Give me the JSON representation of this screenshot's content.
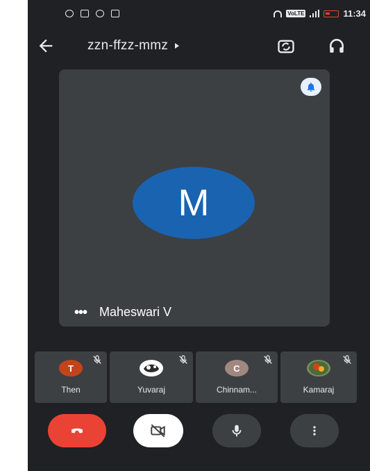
{
  "status_bar": {
    "time": "11:34",
    "volte": "VoLTE"
  },
  "header": {
    "meeting_code": "zzn-ffzz-mmz"
  },
  "main_tile": {
    "avatar_initial": "M",
    "participant_name": "Maheswari V",
    "more_label": "•••"
  },
  "participants": [
    {
      "name": "Then",
      "initial": "T",
      "avatar_color": "#c5431a"
    },
    {
      "name": "Yuvaraj",
      "initial": "",
      "avatar_color": "#ffffff"
    },
    {
      "name": "Chinnam...",
      "initial": "C",
      "avatar_color": "#a1887f"
    },
    {
      "name": "Kamaraj",
      "initial": "",
      "avatar_color": "#7a8c5a"
    }
  ],
  "colors": {
    "background": "#202124",
    "tile": "#3c4043",
    "end_call": "#ea4335",
    "avatar_big": "#1a63b0",
    "badge": "#e8f0fe",
    "badge_icon": "#1a73e8"
  },
  "icons": {
    "back": "arrow-left",
    "switch_camera": "switch-camera",
    "audio": "headphones",
    "bell": "bell",
    "end_call": "phone-hangup",
    "camera": "video-off",
    "mic": "microphone",
    "more": "dots-vertical",
    "mute": "mic-off"
  }
}
